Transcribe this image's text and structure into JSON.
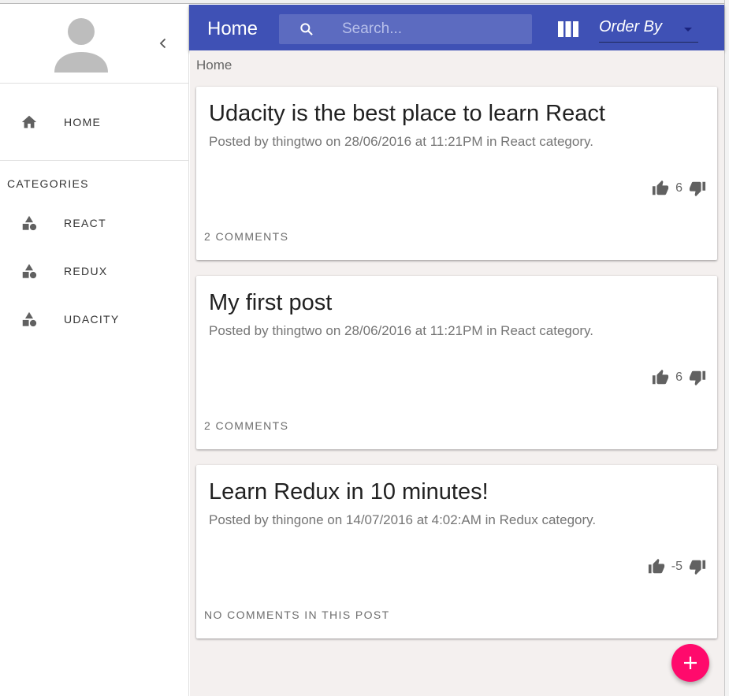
{
  "app": {
    "title": "Home"
  },
  "search": {
    "placeholder": "Search..."
  },
  "order_by": {
    "selected": "Order By"
  },
  "sidebar": {
    "home_label": "HOME",
    "categories_title": "CATEGORIES",
    "categories": [
      {
        "label": "REACT"
      },
      {
        "label": "REDUX"
      },
      {
        "label": "UDACITY"
      }
    ]
  },
  "breadcrumb": "Home",
  "posts": [
    {
      "title": "Udacity is the best place to learn React",
      "meta": "Posted by thingtwo on 28/06/2016 at 11:21PM in React category.",
      "score": "6",
      "comments": "2 COMMENTS"
    },
    {
      "title": "My first post",
      "meta": "Posted by thingtwo on 28/06/2016 at 11:21PM in React category.",
      "score": "6",
      "comments": "2 COMMENTS"
    },
    {
      "title": "Learn Redux in 10 minutes!",
      "meta": "Posted by thingone on 14/07/2016 at 4:02:AM in Redux category.",
      "score": "-5",
      "comments": "NO COMMENTS IN THIS POST"
    }
  ],
  "icons": {
    "avatar": "person-icon",
    "collapse": "chevron-left-icon",
    "home": "home-icon",
    "category": "category-icon",
    "search": "search-icon",
    "view": "view-column-icon",
    "upvote": "thumb-up-icon",
    "downvote": "thumb-down-icon",
    "add": "add-icon"
  },
  "colors": {
    "appbar": "#3f51b5",
    "search_bg": "#5c6bc0",
    "fab": "#ff0a6c",
    "main_bg": "#f4f0ef"
  }
}
